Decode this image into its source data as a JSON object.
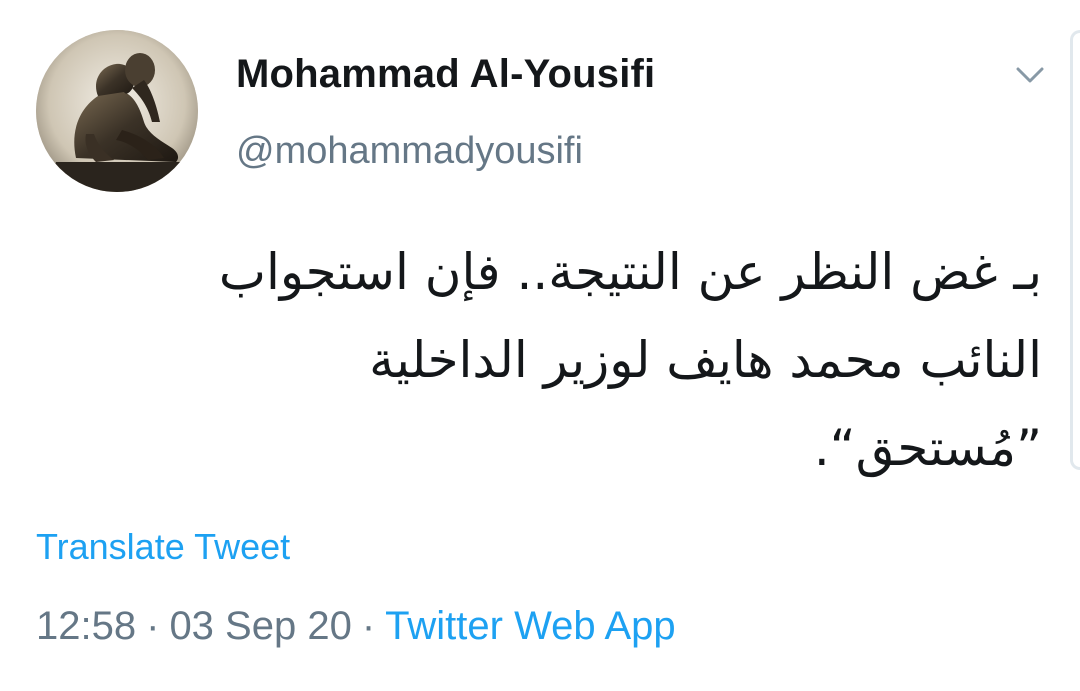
{
  "user": {
    "display_name": "Mohammad Al-Yousifi",
    "handle": "@mohammadyousifi",
    "avatar_icon": "thinker-statue-avatar"
  },
  "menu": {
    "icon": "chevron-down-icon"
  },
  "tweet": {
    "lines": [
      "بـ غض النظر عن النتيجة.. فإن استجواب",
      "النائب محمد هايف لوزير الداخلية",
      "”مُستحق“."
    ]
  },
  "translate_label": "Translate Tweet",
  "meta": {
    "time": "12:58",
    "date": "03 Sep 20",
    "separator": "·",
    "source": "Twitter Web App"
  },
  "colors": {
    "text": "#14171a",
    "secondary": "#657786",
    "link": "#1da1f2"
  }
}
